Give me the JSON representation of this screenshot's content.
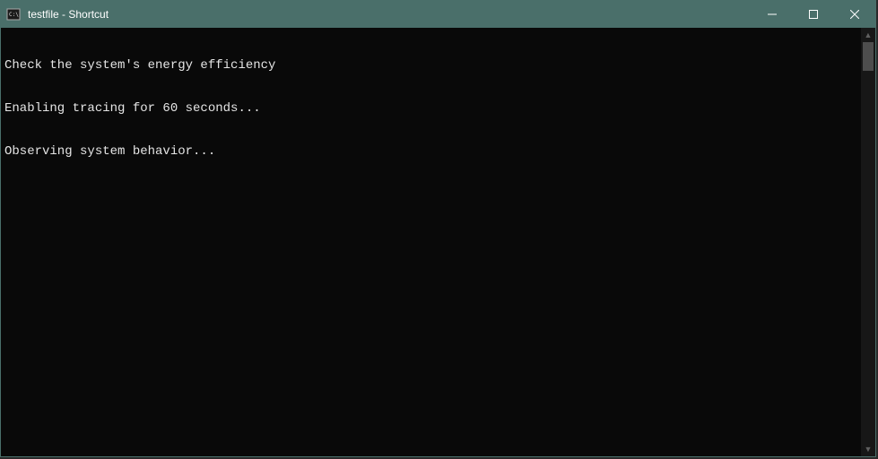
{
  "window": {
    "title": "testfile - Shortcut"
  },
  "console": {
    "lines": [
      "Check the system's energy efficiency",
      "Enabling tracing for 60 seconds...",
      "Observing system behavior..."
    ]
  },
  "colors": {
    "titlebar": "#4a6f6a",
    "console_bg": "#090909",
    "console_fg": "#e5e5e5"
  }
}
